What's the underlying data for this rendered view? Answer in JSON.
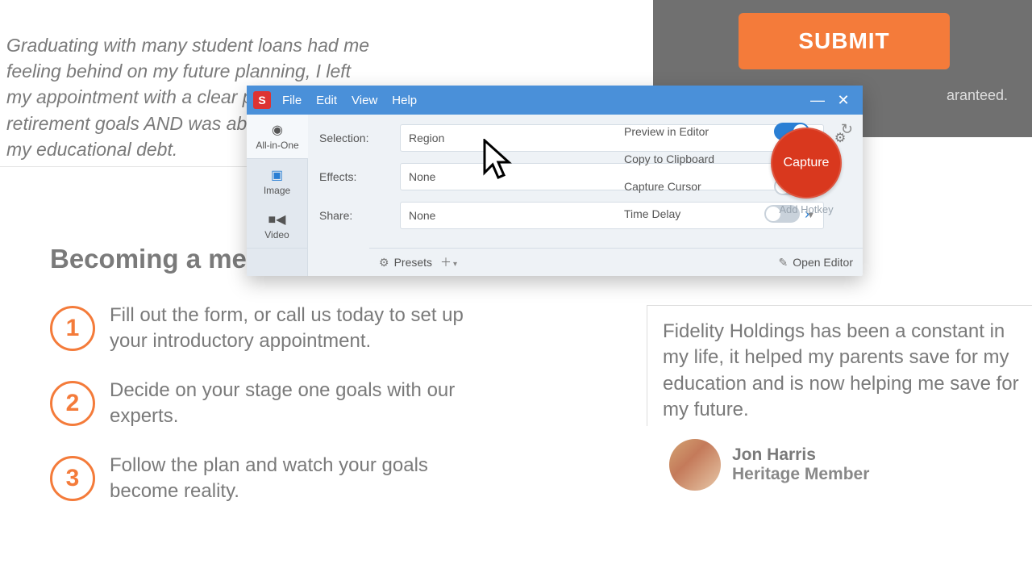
{
  "page": {
    "testimonial_top": "Graduating with many student loans had me feeling behind on my future planning, I left my appointment with a clear path to my retirement goals AND was able to pay down my educational debt.",
    "section_title": "Becoming a member",
    "steps": [
      "Fill out the form, or call us today to set up your introductory appointment.",
      "Decide on your stage one goals with our experts.",
      "Follow the plan and watch your goals become reality."
    ],
    "testimonial_right": "Fidelity Holdings has been a constant in my life, it helped my parents save for my education and is now helping me save for my future.",
    "author_name": "Jon Harris",
    "author_role": "Heritage Member",
    "submit_label": "SUBMIT",
    "cta_note": "aranteed."
  },
  "snagit": {
    "menu": {
      "file": "File",
      "edit": "Edit",
      "view": "View",
      "help": "Help"
    },
    "tabs": {
      "all": "All-in-One",
      "image": "Image",
      "video": "Video"
    },
    "labels": {
      "selection": "Selection:",
      "effects": "Effects:",
      "share": "Share:"
    },
    "dropdowns": {
      "selection": "Region",
      "effects": "None",
      "share": "None"
    },
    "toggles": {
      "preview": "Preview in Editor",
      "copy": "Copy to Clipboard",
      "cursor": "Capture Cursor",
      "delay": "Time Delay"
    },
    "capture": "Capture",
    "hotkey": "Add Hotkey",
    "presets": "Presets",
    "open_editor": "Open Editor"
  }
}
